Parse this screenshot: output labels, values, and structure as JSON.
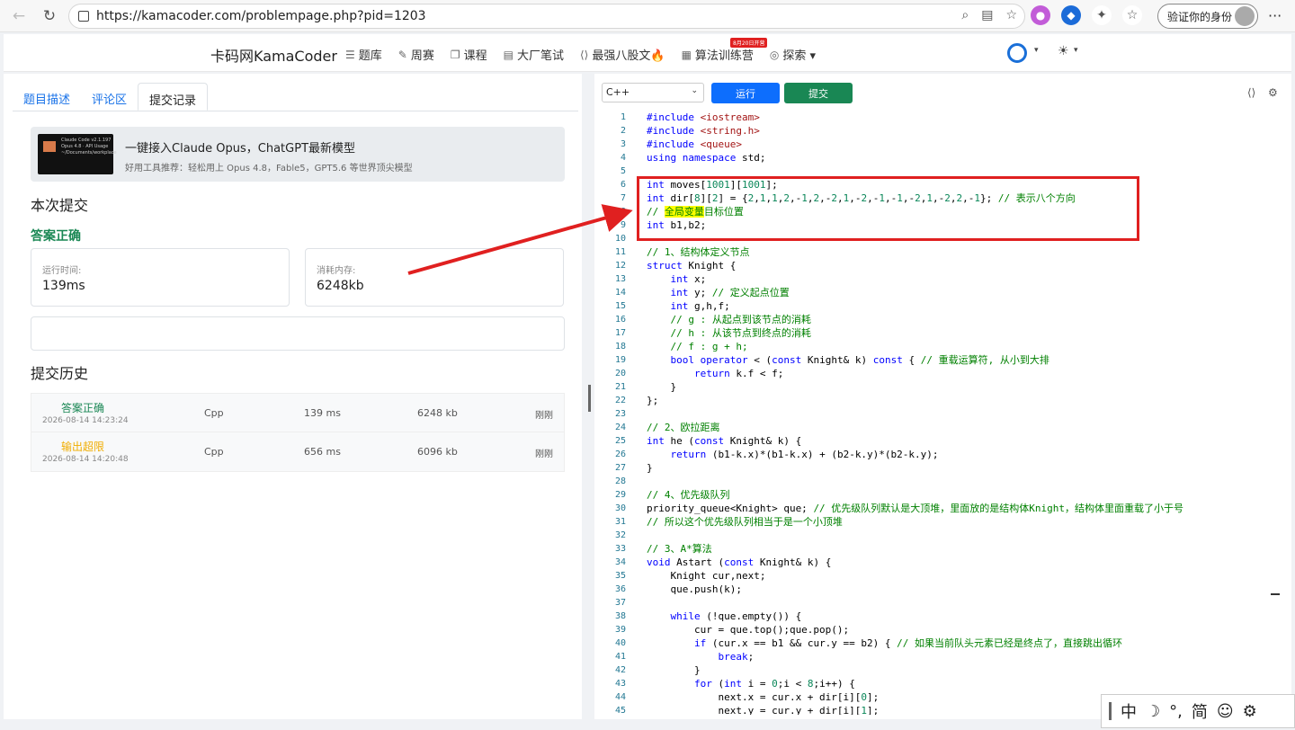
{
  "browser": {
    "url": "https://kamacoder.com/problempage.php?pid=1203",
    "profile_label": "验证你的身份"
  },
  "header": {
    "brand": "卡码网KamaCoder",
    "nav": [
      {
        "label": "题库",
        "icon": "list-icon"
      },
      {
        "label": "周赛",
        "icon": "pencil-icon"
      },
      {
        "label": "课程",
        "icon": "copy-icon"
      },
      {
        "label": "大厂笔试",
        "icon": "doc-icon"
      },
      {
        "label": "最强八股文🔥",
        "icon": "code-icon"
      },
      {
        "label": "算法训练营",
        "icon": "calendar-icon"
      },
      {
        "label": "探索 ▾",
        "icon": "compass-icon"
      }
    ],
    "promo_badge": "8月20日开营"
  },
  "left": {
    "tabs": [
      "题目描述",
      "评论区",
      "提交记录"
    ],
    "active_tab": 2,
    "ad": {
      "title": "一键接入Claude Opus，ChatGPT最新模型",
      "subtitle": "好用工具推荐：轻松用上 Opus 4.8，Fable5，GPT5.6 等世界顶尖模型",
      "thumb_text": "Claude Code v2.1.197\nOpus 4.8 · API Usage\n~/Documents/workplace"
    },
    "current_title": "本次提交",
    "status": "答案正确",
    "runtime_label": "运行时间:",
    "runtime_value": "139ms",
    "memory_label": "消耗内存:",
    "memory_value": "6248kb",
    "history_title": "提交历史",
    "history": [
      {
        "status": "答案正确",
        "status_color": "#198754",
        "date": "2026-08-14 14:23:24",
        "lang": "Cpp",
        "time": "139 ms",
        "mem": "6248 kb",
        "when": "刚刚"
      },
      {
        "status": "输出超限",
        "status_color": "#f0ad00",
        "date": "2026-08-14 14:20:48",
        "lang": "Cpp",
        "time": "656 ms",
        "mem": "6096 kb",
        "when": "刚刚"
      }
    ]
  },
  "editor": {
    "language": "C++",
    "run_label": "运行",
    "submit_label": "提交",
    "lines": [
      "#include <iostream>",
      "#include <string.h>",
      "#include <queue>",
      "using namespace std;",
      "",
      "int moves[1001][1001];",
      "int dir[8][2] = {2,1,1,2,-1,2,-2,1,-2,-1,-1,-2,1,-2,2,-1}; // 表示八个方向",
      "// 全局变量目标位置",
      "int b1,b2;",
      "",
      "// 1、结构体定义节点",
      "struct Knight {",
      "    int x;",
      "    int y; // 定义起点位置",
      "    int g,h,f;",
      "    // g : 从起点到该节点的消耗",
      "    // h : 从该节点到终点的消耗",
      "    // f : g + h;",
      "    bool operator < (const Knight& k) const { // 重载运算符, 从小到大排",
      "        return k.f < f;",
      "    }",
      "};",
      "",
      "// 2、欧拉距离",
      "int he (const Knight& k) {",
      "    return (b1-k.x)*(b1-k.x) + (b2-k.y)*(b2-k.y);",
      "}",
      "",
      "// 4、优先级队列",
      "priority_queue<Knight> que; // 优先级队列默认是大顶堆，里面放的是结构体Knight，结构体里面重载了小于号",
      "// 所以这个优先级队列相当于是一个小顶堆",
      "",
      "// 3、A*算法",
      "void Astart (const Knight& k) {",
      "    Knight cur,next;",
      "    que.push(k);",
      "",
      "    while (!que.empty()) {",
      "        cur = que.top();que.pop();",
      "        if (cur.x == b1 && cur.y == b2) { // 如果当前队头元素已经是终点了，直接跳出循环",
      "            break;",
      "        }",
      "        for (int i = 0;i < 8;i++) {",
      "            next.x = cur.x + dir[i][0];",
      "            next.y = cur.y + dir[i][1];"
    ]
  },
  "ime": {
    "items": [
      "中",
      "☽",
      "°,",
      "简",
      "☺",
      "⚙"
    ]
  }
}
